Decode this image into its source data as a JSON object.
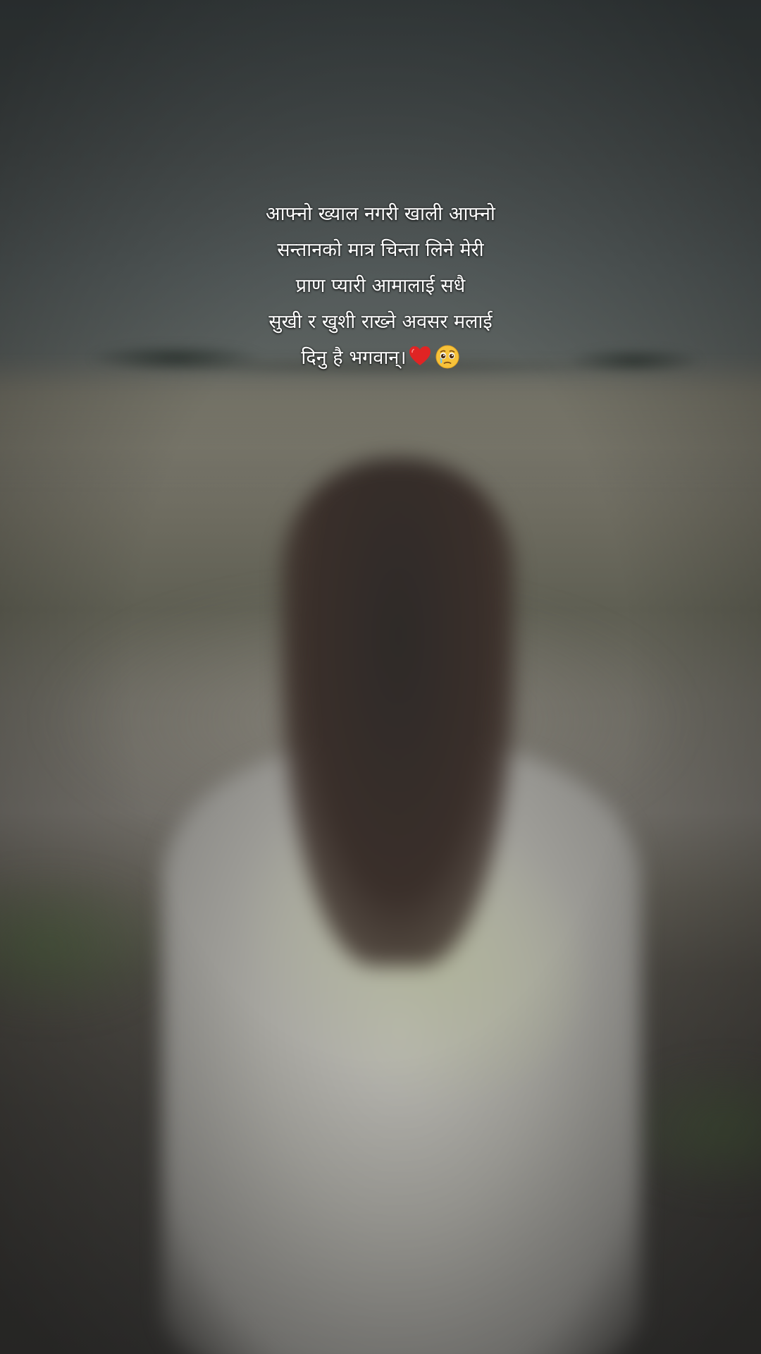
{
  "caption": {
    "lines": [
      "आफ्नो ख्याल नगरी खाली आफ्नो",
      "सन्तानको मात्र चिन्ता लिने मेरी",
      "प्राण प्यारी आमालाई सधै",
      "सुखी र खुशी राख्ने अवसर मलाई",
      "दिनु है भगवान्।"
    ],
    "emojis": [
      "heart-icon",
      "pleading-face-icon"
    ]
  },
  "colors": {
    "caption_text": "#ffffff",
    "heart": "#e02424",
    "emoji_face": "#f7c23a"
  }
}
